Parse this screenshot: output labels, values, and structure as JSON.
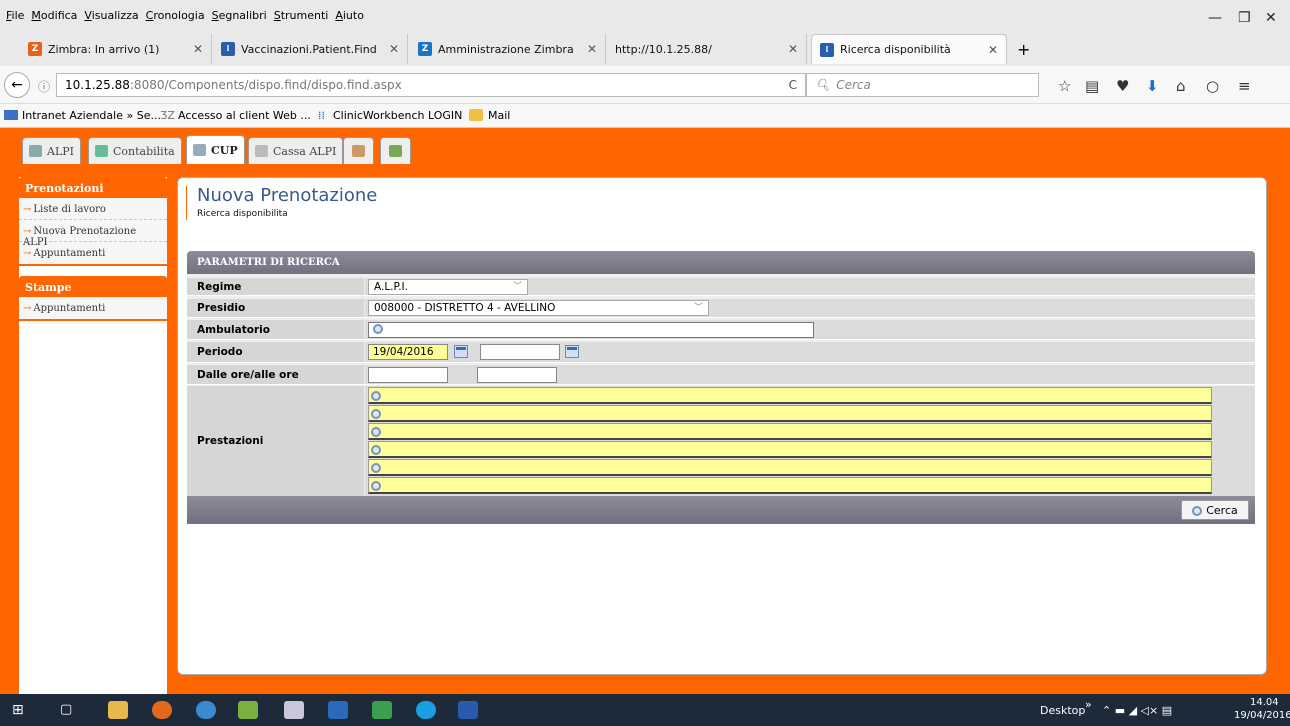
{
  "menu": [
    "File",
    "Modifica",
    "Visualizza",
    "Cronologia",
    "Segnalibri",
    "Strumenti",
    "Aiuto"
  ],
  "browser_tabs": [
    {
      "label": "Zimbra: In arrivo (1)",
      "fav_color": "#e8611a",
      "fav_text": "Z"
    },
    {
      "label": "Vaccinazioni.Patient.Find",
      "fav_color": "#2a5db0",
      "fav_text": "⁞"
    },
    {
      "label": "Amministrazione Zimbra",
      "fav_color": "#1a73c9",
      "fav_text": "Z"
    },
    {
      "label": "http://10.1.25.88/",
      "fav_color": "",
      "fav_text": ""
    },
    {
      "label": "Ricerca disponibilità",
      "fav_color": "#2a5db0",
      "fav_text": "⁞"
    }
  ],
  "url": {
    "host": "10.1.25.88",
    "rest": ":8080/Components/dispo.find/dispo.find.aspx"
  },
  "search_placeholder": "Cerca",
  "bookmarks": [
    "Intranet Aziendale » Se...",
    "Accesso al client Web ...",
    "ClinicWorkbench LOGIN",
    "Mail"
  ],
  "app_tabs": [
    {
      "label": "ALPI",
      "color": "#8aa"
    },
    {
      "label": "Contabilita",
      "color": "#6b9"
    },
    {
      "label": "CUP",
      "color": "#9ab"
    },
    {
      "label": "Cassa ALPI",
      "color": "#bbb"
    },
    {
      "label": "",
      "color": "#c96"
    },
    {
      "label": "",
      "color": "#7a5"
    }
  ],
  "sidebar": {
    "groups": [
      {
        "title": "Prenotazioni",
        "items": [
          "Liste di lavoro",
          "Nuova Prenotazione ALPI",
          "Appuntamenti"
        ]
      },
      {
        "title": "Stampe",
        "items": [
          "Appuntamenti"
        ]
      }
    ]
  },
  "page": {
    "title": "Nuova Prenotazione",
    "subtitle": "Ricerca disponibilita"
  },
  "form": {
    "header": "PARAMETRI DI RICERCA",
    "labels": {
      "regime": "Regime",
      "presidio": "Presidio",
      "ambulatorio": "Ambulatorio",
      "periodo": "Periodo",
      "orari": "Dalle ore/alle ore",
      "prestazioni": "Prestazioni"
    },
    "regime": "A.L.P.I.",
    "presidio": "008000 - DISTRETTO 4 - AVELLINO",
    "ambulatorio": "",
    "periodo_from": "19/04/2016",
    "periodo_to": "",
    "ora_from": "",
    "ora_to": "",
    "prestazioni_count": 6,
    "search_button": "Cerca"
  },
  "taskbar": {
    "desktop_label": "Desktop",
    "time": "14.04",
    "date": "19/04/2016"
  }
}
